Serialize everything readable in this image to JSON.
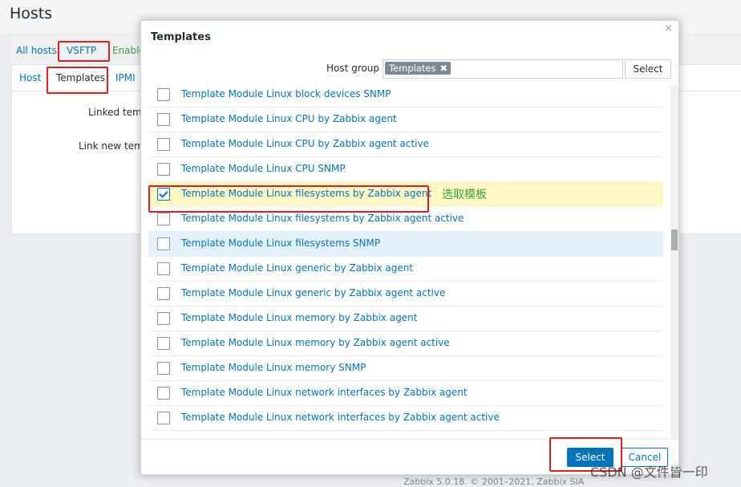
{
  "page": {
    "title": "Hosts",
    "breadcrumbs": [
      "All hosts",
      "VSFTP",
      "Enable"
    ],
    "tabs": [
      "Host",
      "Templates",
      "IPMI"
    ],
    "form_labels": [
      "Linked temp",
      "Link new temp"
    ],
    "footer": "Zabbix 5.0.18. © 2001–2021, Zabbix SIA",
    "watermark": "CSDN @文件皆一印"
  },
  "modal": {
    "title": "Templates",
    "close_icon": "×",
    "host_group_label": "Host group",
    "host_group_chip": "Templates",
    "chip_remove": "✖",
    "select_top_label": "Select",
    "items": [
      {
        "label": "Template Module Linux block devices SNMP",
        "checked": false
      },
      {
        "label": "Template Module Linux CPU by Zabbix agent",
        "checked": false
      },
      {
        "label": "Template Module Linux CPU by Zabbix agent active",
        "checked": false
      },
      {
        "label": "Template Module Linux CPU SNMP",
        "checked": false
      },
      {
        "label": "Template Module Linux filesystems by Zabbix agent",
        "checked": true
      },
      {
        "label": "Template Module Linux filesystems by Zabbix agent active",
        "checked": false
      },
      {
        "label": "Template Module Linux filesystems SNMP",
        "checked": false
      },
      {
        "label": "Template Module Linux generic by Zabbix agent",
        "checked": false
      },
      {
        "label": "Template Module Linux generic by Zabbix agent active",
        "checked": false
      },
      {
        "label": "Template Module Linux memory by Zabbix agent",
        "checked": false
      },
      {
        "label": "Template Module Linux memory by Zabbix agent active",
        "checked": false
      },
      {
        "label": "Template Module Linux memory SNMP",
        "checked": false
      },
      {
        "label": "Template Module Linux network interfaces by Zabbix agent",
        "checked": false
      },
      {
        "label": "Template Module Linux network interfaces by Zabbix agent active",
        "checked": false
      }
    ],
    "annotation": "选取模板",
    "select_label": "Select",
    "cancel_label": "Cancel"
  },
  "colors": {
    "link": "#0275b8",
    "checked_row": "#fff8c5",
    "hover_row": "#e3f1fb",
    "annotation_box": "#e11d1d",
    "annotation_text": "#35a535"
  }
}
